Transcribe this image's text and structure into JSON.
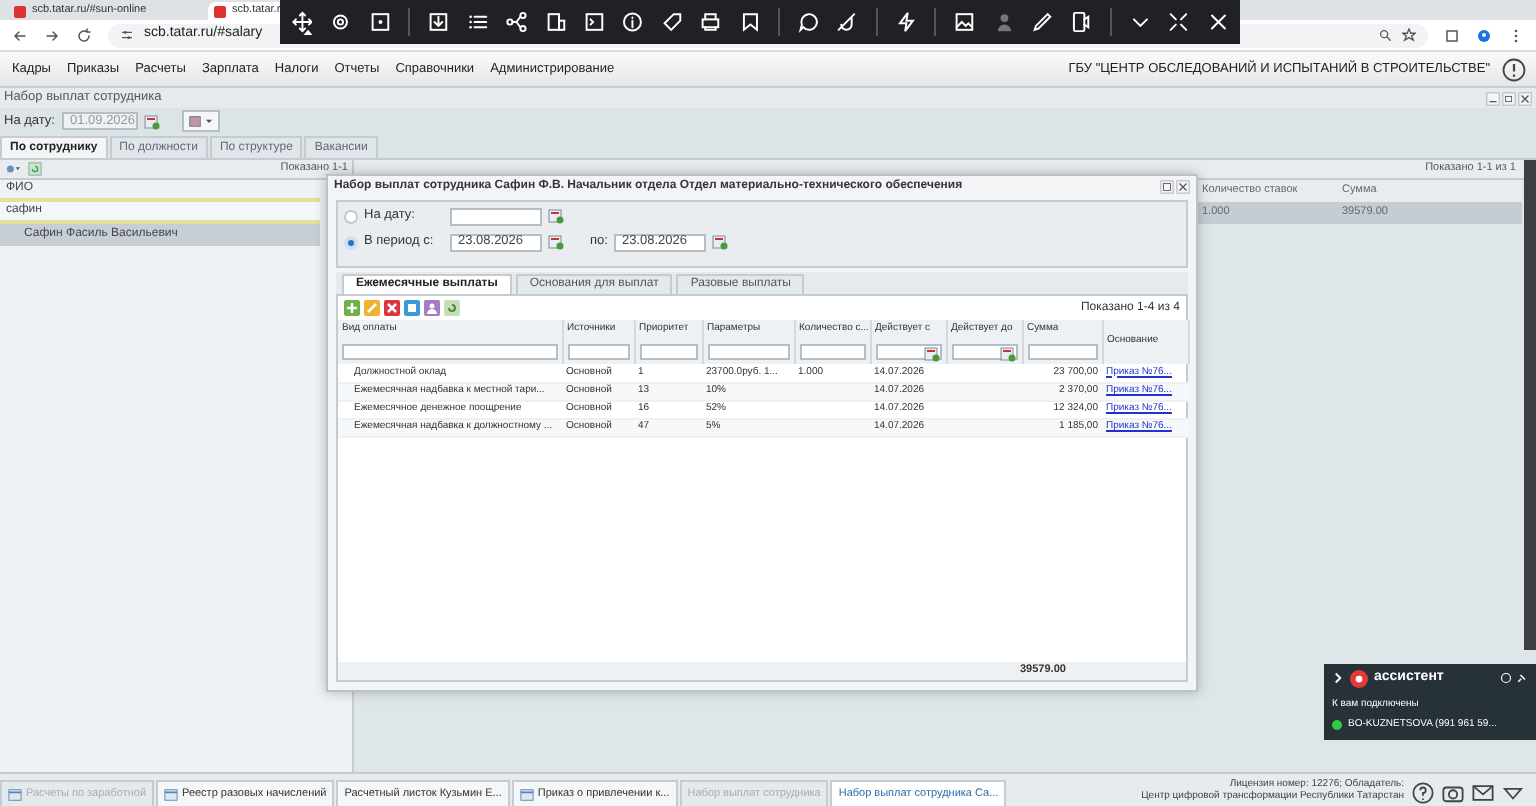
{
  "browser": {
    "tabs": [
      {
        "title": "scb.tatar.ru/#sun-online",
        "selected": false
      },
      {
        "title": "scb.tatar.r",
        "selected": true
      }
    ],
    "address": "scb.tatar.ru/#salary"
  },
  "menu": [
    "Кадры",
    "Приказы",
    "Расчеты",
    "Зарплата",
    "Налоги",
    "Отчеты",
    "Справочники",
    "Администрирование"
  ],
  "organization": "ГБУ \"ЦЕНТР ОБСЛЕДОВАНИЙ И ИСПЫТАНИЙ В СТРОИТЕЛЬСТВЕ\"",
  "panel": {
    "title": "Набор выплат сотрудника",
    "date_label": "На дату:",
    "date": "01.09.2026",
    "tabs": [
      {
        "label": "По сотруднику",
        "selected": true
      },
      {
        "label": "По должности",
        "selected": false
      },
      {
        "label": "По структуре",
        "selected": false
      },
      {
        "label": "Вакансии",
        "selected": false
      }
    ],
    "left": {
      "shown": "Показано 1-1",
      "column": "ФИО",
      "filter": "сафин",
      "rows": [
        {
          "name": "Сафин Фасиль Васильевич",
          "selected": true
        }
      ]
    },
    "right": {
      "shown": "Показано 1-1 из 1",
      "columns": [
        "Количество ставок",
        "Сумма"
      ],
      "rows": [
        {
          "cells": [
            "1.000",
            "39579.00"
          ],
          "selected": true
        }
      ]
    }
  },
  "dialog": {
    "title": "Набор выплат сотрудника Сафин Ф.В. Начальник отдела Отдел материально-технического обеспечения",
    "modes": [
      {
        "label": "На дату:",
        "selected": false
      },
      {
        "label": "В период с:",
        "selected": true,
        "value": "23.08.2026",
        "to_label": "по:",
        "to_value": "23.08.2026"
      }
    ],
    "tabs": [
      {
        "label": "Ежемесячные выплаты",
        "selected": true
      },
      {
        "label": "Основания для выплат",
        "selected": false
      },
      {
        "label": "Разовые выплаты",
        "selected": false
      }
    ],
    "shown": "Показано 1-4 из 4",
    "columns": [
      {
        "label": "Вид оплаты",
        "kind": "text"
      },
      {
        "label": "Источники",
        "kind": "text"
      },
      {
        "label": "Приоритет",
        "kind": "text"
      },
      {
        "label": "Параметры",
        "kind": "text"
      },
      {
        "label": "Количество с...",
        "kind": "text"
      },
      {
        "label": "Действует с",
        "kind": "date"
      },
      {
        "label": "Действует до",
        "kind": "date"
      },
      {
        "label": "Сумма",
        "kind": "text"
      },
      {
        "label": "Основание",
        "kind": "plain"
      }
    ],
    "rows": [
      {
        "cells": [
          "Должностной оклад",
          "Основной",
          "1",
          "23700.0руб. 1...",
          "1.000",
          "14.07.2026",
          "",
          "23 700,00"
        ],
        "basis": "Приказ №76..."
      },
      {
        "cells": [
          "Ежемесячная надбавка к местной тари...",
          "Основной",
          "13",
          "10%",
          "",
          "14.07.2026",
          "",
          "2 370,00"
        ],
        "basis": "Приказ №76..."
      },
      {
        "cells": [
          "Ежемесячное денежное поощрение",
          "Основной",
          "16",
          "52%",
          "",
          "14.07.2026",
          "",
          "12 324,00"
        ],
        "basis": "Приказ №76..."
      },
      {
        "cells": [
          "Ежемесячная надбавка к должностному ...",
          "Основной",
          "47",
          "5%",
          "",
          "14.07.2026",
          "",
          "1 185,00"
        ],
        "basis": "Приказ №76..."
      }
    ],
    "total": "39579.00"
  },
  "assistant": {
    "title": "ассистент",
    "status": "К вам подключены",
    "user": "BO-KUZNETSOVA (991 961 59...",
    "online": true
  },
  "taskbar": [
    {
      "label": "Расчеты по заработной",
      "icon": true,
      "selected": false,
      "disabled": true
    },
    {
      "label": "Реестр разовых начислений",
      "icon": true,
      "selected": false,
      "disabled": false
    },
    {
      "label": "Расчетный листок Кузьмин Е...",
      "icon": false,
      "selected": false,
      "disabled": false
    },
    {
      "label": "Приказ о привлечении к...",
      "icon": true,
      "selected": false,
      "disabled": false
    },
    {
      "label": "Набор выплат сотрудника",
      "icon": false,
      "selected": false,
      "disabled": true
    },
    {
      "label": "Набор выплат сотрудника Са...",
      "icon": false,
      "selected": true,
      "disabled": false
    }
  ],
  "license": [
    "Лицензия номер: 12276; Обладатель:",
    "Центр цифровой трансформации Республики Татарстан"
  ]
}
